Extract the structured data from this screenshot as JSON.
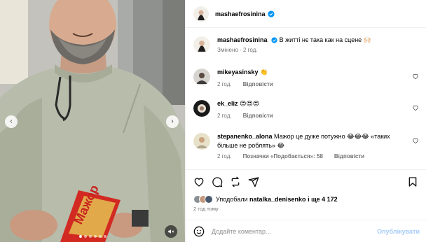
{
  "post": {
    "author": "mashaefrosinina",
    "verified": true
  },
  "caption": {
    "author": "mashaefrosinina",
    "text": "В житті нє така как на сцене 🙌🏻",
    "edited": "Змінено",
    "time": "2 год."
  },
  "comments": [
    {
      "user": "mikeyasinsky",
      "text": "👏",
      "time": "2 год.",
      "reply": "Відповісти",
      "likes": ""
    },
    {
      "user": "ek_eliz",
      "text": "😍😍😍",
      "time": "2 год.",
      "reply": "Відповісти",
      "likes": ""
    },
    {
      "user": "stepanenko_alona",
      "text": "Мажор це дуже потужно 😂😂😂 «таких більше не роблять» 😂",
      "time": "2 год.",
      "reply": "Відповісти",
      "likes": "Позначки «Подобається»: 58"
    }
  ],
  "likes": {
    "prefix": "Уподобали",
    "user": "natalka_denisenko",
    "suffix": "і ще 4 172"
  },
  "timestamp": "2 год тому",
  "composer": {
    "placeholder": "Додайте коментар...",
    "publish": "Опублікувати"
  },
  "media": {
    "package_text": "Мажор",
    "carousel_dots": 6,
    "active_dot": 1
  },
  "icons": {
    "like": "heart-icon",
    "comment": "comment-icon",
    "share": "share-icon",
    "save": "bookmark-icon",
    "emoji": "emoji-icon",
    "mute": "speaker-muted-icon"
  },
  "colors": {
    "verified": "#0095f6",
    "publish_disabled": "#a6cdf6",
    "muted_text": "#737373"
  }
}
